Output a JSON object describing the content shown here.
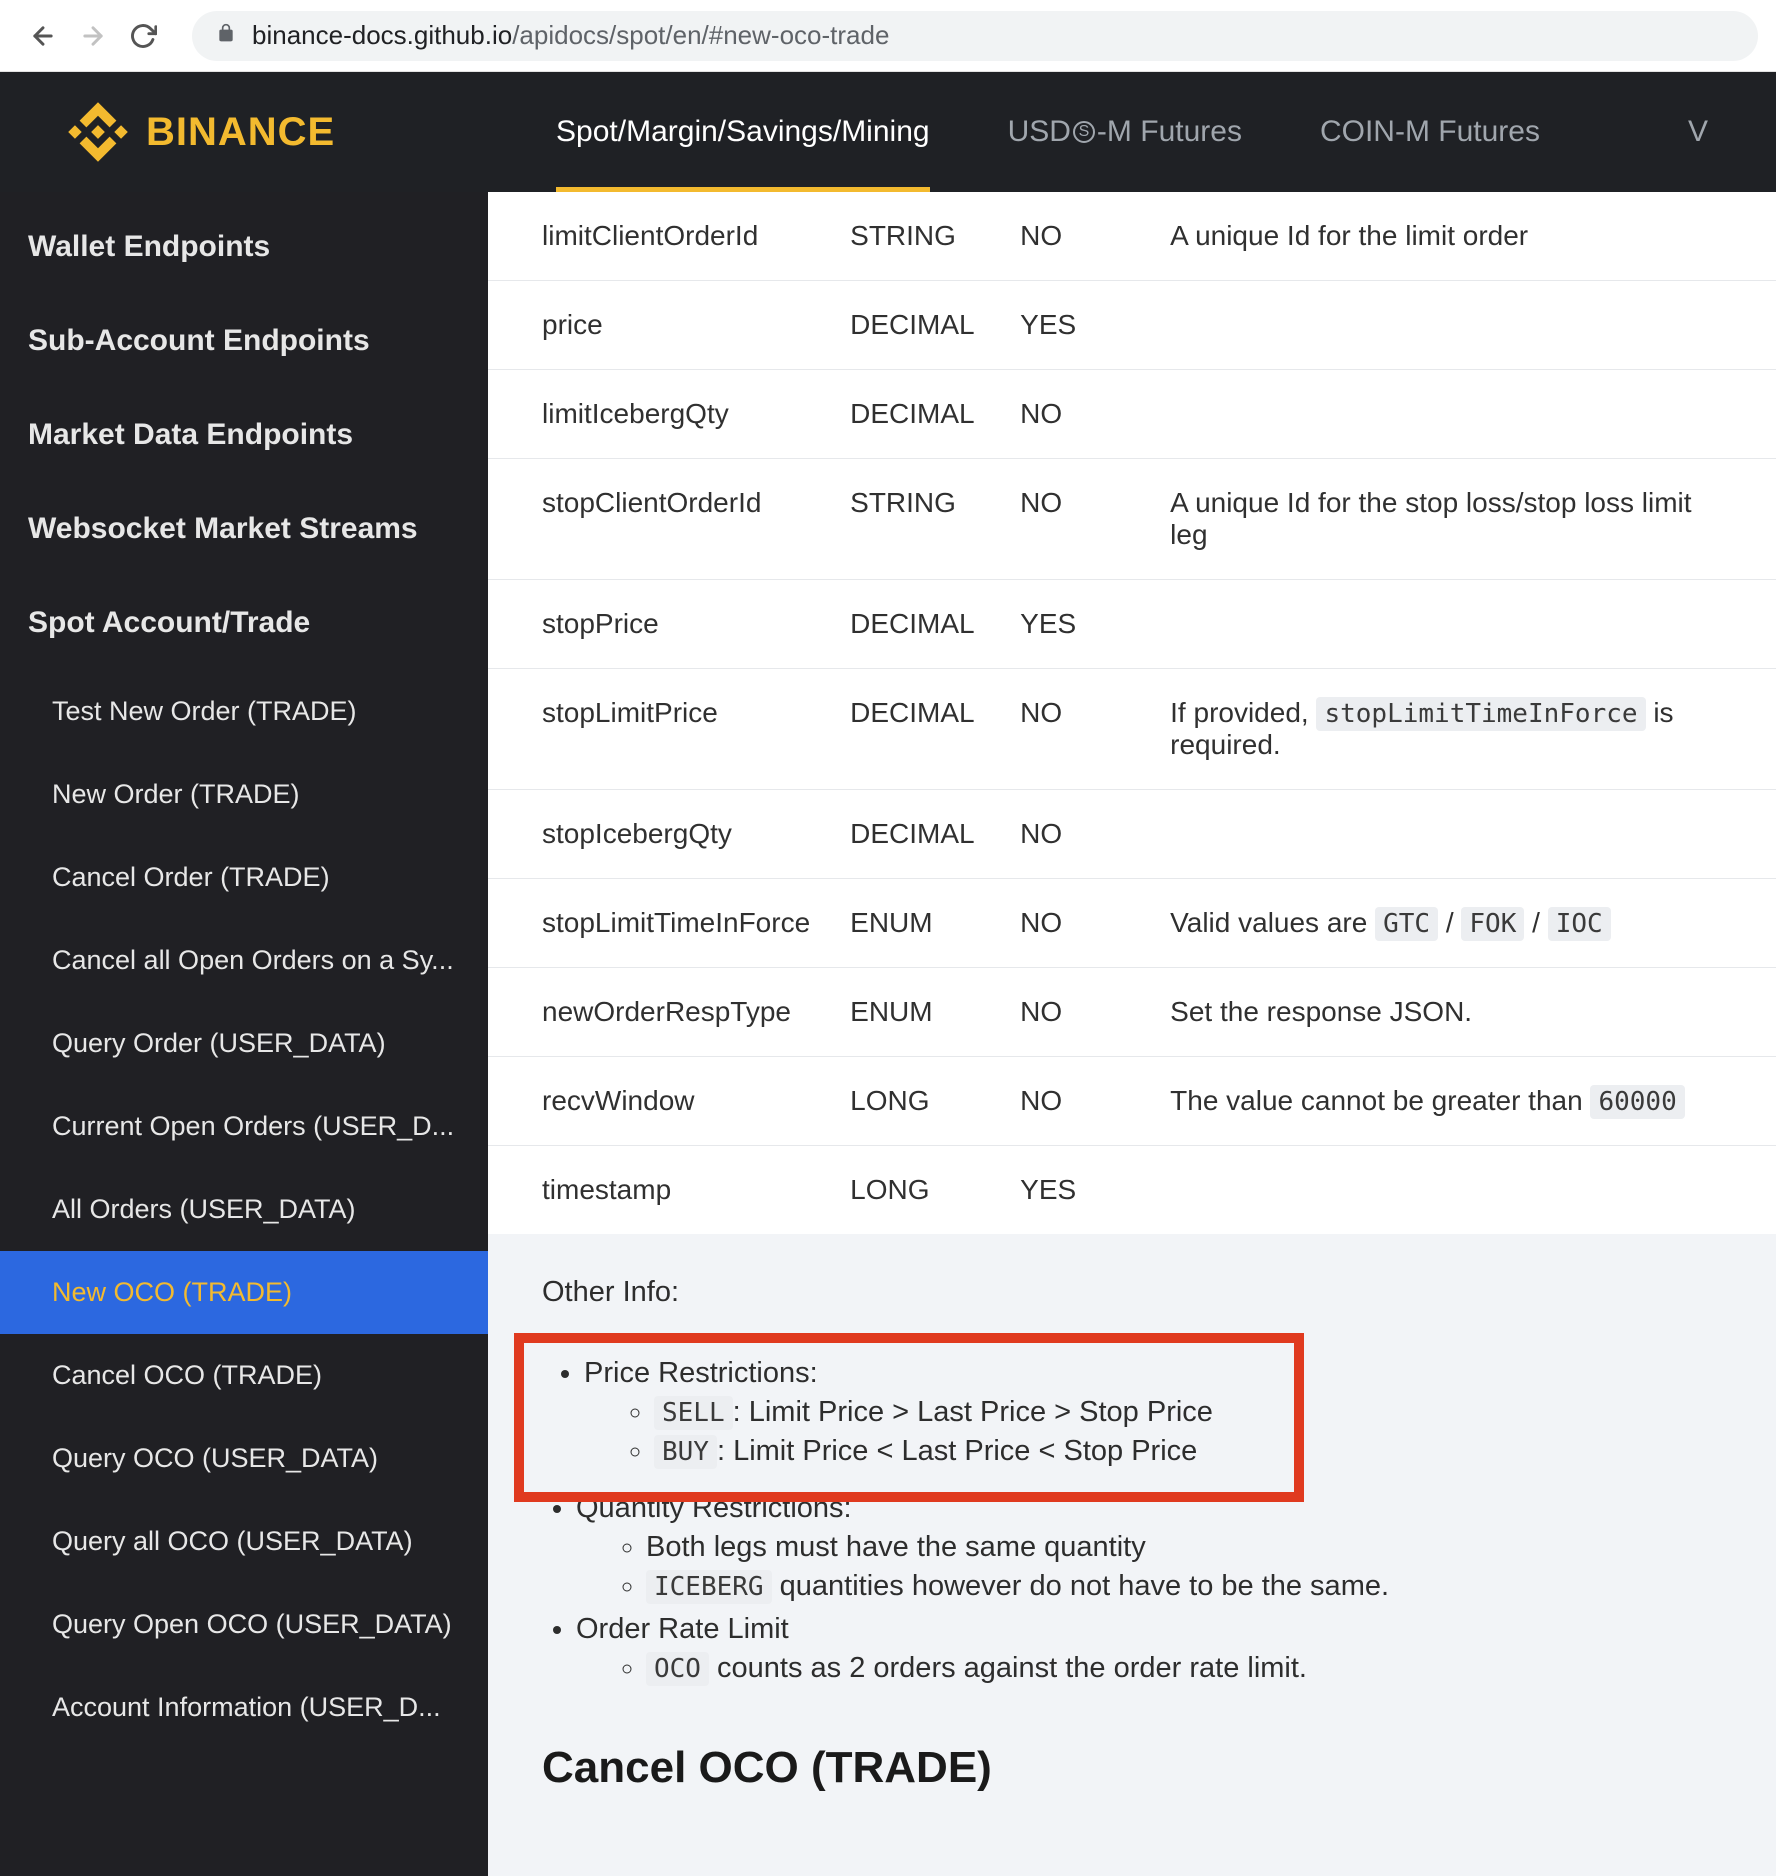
{
  "browser": {
    "url_host": "binance-docs.github.io",
    "url_path": "/apidocs/spot/en/#new-oco-trade"
  },
  "logo_text": "BINANCE",
  "topnav": {
    "tabs": [
      {
        "label": "Spot/Margin/Savings/Mining",
        "active": true
      },
      {
        "label_pre": "USD",
        "label_circled": "S",
        "label_post": "-M Futures",
        "active": false
      },
      {
        "label": "COIN-M Futures",
        "active": false
      }
    ],
    "extra": "V"
  },
  "sidebar": {
    "sections": [
      "Wallet Endpoints",
      "Sub-Account Endpoints",
      "Market Data Endpoints",
      "Websocket Market Streams",
      "Spot Account/Trade"
    ],
    "items": [
      "Test New Order (TRADE)",
      "New Order (TRADE)",
      "Cancel Order (TRADE)",
      "Cancel all Open Orders on a Sy...",
      "Query Order (USER_DATA)",
      "Current Open Orders (USER_D...",
      "All Orders (USER_DATA)",
      "New OCO (TRADE)",
      "Cancel OCO (TRADE)",
      "Query OCO (USER_DATA)",
      "Query all OCO (USER_DATA)",
      "Query Open OCO (USER_DATA)",
      "Account Information (USER_D..."
    ],
    "active_index": 7
  },
  "table": {
    "rows": [
      {
        "name": "limitClientOrderId",
        "type": "STRING",
        "mandatory": "NO",
        "desc": "A unique Id for the limit order"
      },
      {
        "name": "price",
        "type": "DECIMAL",
        "mandatory": "YES",
        "desc": ""
      },
      {
        "name": "limitIcebergQty",
        "type": "DECIMAL",
        "mandatory": "NO",
        "desc": ""
      },
      {
        "name": "stopClientOrderId",
        "type": "STRING",
        "mandatory": "NO",
        "desc": "A unique Id for the stop loss/stop loss limit leg"
      },
      {
        "name": "stopPrice",
        "type": "DECIMAL",
        "mandatory": "YES",
        "desc": ""
      },
      {
        "name": "stopLimitPrice",
        "type": "DECIMAL",
        "mandatory": "NO",
        "desc_pre": "If provided, ",
        "desc_code": "stopLimitTimeInForce",
        "desc_post": " is required."
      },
      {
        "name": "stopIcebergQty",
        "type": "DECIMAL",
        "mandatory": "NO",
        "desc": ""
      },
      {
        "name": "stopLimitTimeInForce",
        "type": "ENUM",
        "mandatory": "NO",
        "desc_pre": "Valid values are ",
        "desc_codes": [
          "GTC",
          "FOK",
          "IOC"
        ]
      },
      {
        "name": "newOrderRespType",
        "type": "ENUM",
        "mandatory": "NO",
        "desc": "Set the response JSON."
      },
      {
        "name": "recvWindow",
        "type": "LONG",
        "mandatory": "NO",
        "desc_pre": "The value cannot be greater than ",
        "desc_code": "60000"
      },
      {
        "name": "timestamp",
        "type": "LONG",
        "mandatory": "YES",
        "desc": ""
      }
    ]
  },
  "other_info": {
    "heading": "Other Info:",
    "price_restrictions": {
      "title": "Price Restrictions:",
      "sell_code": "SELL",
      "sell_text": ": Limit Price > Last Price > Stop Price",
      "buy_code": "BUY",
      "buy_text": ": Limit Price < Last Price < Stop Price"
    },
    "quantity_restrictions": {
      "title": "Quantity Restrictions:",
      "line1": "Both legs must have the same quantity",
      "line2_code": "ICEBERG",
      "line2_text": " quantities however do not have to be the same."
    },
    "order_rate_limit": {
      "title": "Order Rate Limit",
      "line_code": "OCO",
      "line_text": " counts as 2 orders against the order rate limit."
    }
  },
  "next_heading": "Cancel OCO (TRADE)"
}
